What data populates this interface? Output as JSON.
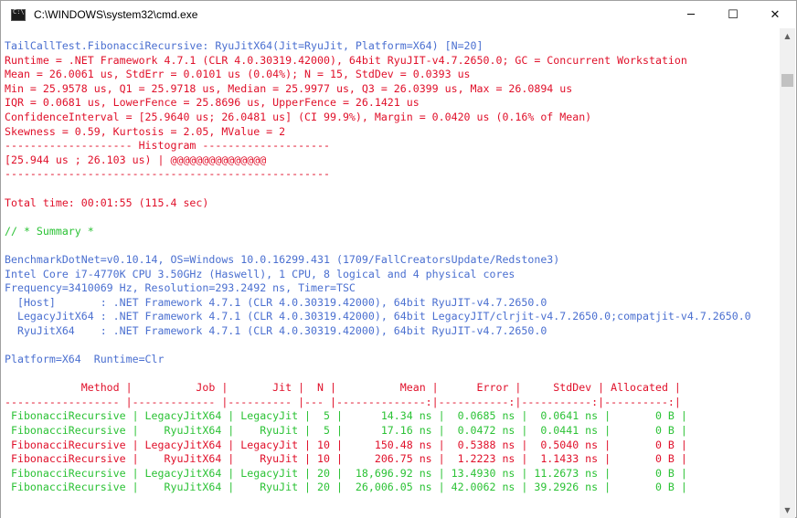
{
  "window": {
    "title": "C:\\WINDOWS\\system32\\cmd.exe",
    "minimize": "─",
    "maximize": "☐",
    "close": "✕"
  },
  "scrollbar": {
    "up": "▲",
    "down": "▼"
  },
  "console": {
    "lines": [
      {
        "color": "blue",
        "text": "TailCallTest.FibonacciRecursive: RyuJitX64(Jit=RyuJit, Platform=X64) [N=20]"
      },
      {
        "color": "red",
        "text": "Runtime = .NET Framework 4.7.1 (CLR 4.0.30319.42000), 64bit RyuJIT-v4.7.2650.0; GC = Concurrent Workstation"
      },
      {
        "color": "red",
        "text": "Mean = 26.0061 us, StdErr = 0.0101 us (0.04%); N = 15, StdDev = 0.0393 us"
      },
      {
        "color": "red",
        "text": "Min = 25.9578 us, Q1 = 25.9718 us, Median = 25.9977 us, Q3 = 26.0399 us, Max = 26.0894 us"
      },
      {
        "color": "red",
        "text": "IQR = 0.0681 us, LowerFence = 25.8696 us, UpperFence = 26.1421 us"
      },
      {
        "color": "red",
        "text": "ConfidenceInterval = [25.9640 us; 26.0481 us] (CI 99.9%), Margin = 0.0420 us (0.16% of Mean)"
      },
      {
        "color": "red",
        "text": "Skewness = 0.59, Kurtosis = 2.05, MValue = 2"
      },
      {
        "color": "red",
        "text": "-------------------- Histogram --------------------"
      },
      {
        "color": "red",
        "text": "[25.944 us ; 26.103 us) | @@@@@@@@@@@@@@@"
      },
      {
        "color": "red",
        "text": "---------------------------------------------------"
      },
      {
        "color": "red",
        "text": ""
      },
      {
        "color": "red",
        "text": "Total time: 00:01:55 (115.4 sec)"
      },
      {
        "color": "red",
        "text": ""
      },
      {
        "color": "green",
        "text": "// * Summary *"
      },
      {
        "color": "green",
        "text": ""
      },
      {
        "color": "blue",
        "text": "BenchmarkDotNet=v0.10.14, OS=Windows 10.0.16299.431 (1709/FallCreatorsUpdate/Redstone3)"
      },
      {
        "color": "blue",
        "text": "Intel Core i7-4770K CPU 3.50GHz (Haswell), 1 CPU, 8 logical and 4 physical cores"
      },
      {
        "color": "blue",
        "text": "Frequency=3410069 Hz, Resolution=293.2492 ns, Timer=TSC"
      },
      {
        "color": "blue",
        "text": "  [Host]       : .NET Framework 4.7.1 (CLR 4.0.30319.42000), 64bit RyuJIT-v4.7.2650.0"
      },
      {
        "color": "blue",
        "text": "  LegacyJitX64 : .NET Framework 4.7.1 (CLR 4.0.30319.42000), 64bit LegacyJIT/clrjit-v4.7.2650.0;compatjit-v4.7.2650.0"
      },
      {
        "color": "blue",
        "text": "  RyuJitX64    : .NET Framework 4.7.1 (CLR 4.0.30319.42000), 64bit RyuJIT-v4.7.2650.0"
      },
      {
        "color": "blue",
        "text": ""
      },
      {
        "color": "blue",
        "text": "Platform=X64  Runtime=Clr"
      },
      {
        "color": "blue",
        "text": ""
      },
      {
        "color": "red",
        "text": "            Method |          Job |       Jit |  N |          Mean |      Error |     StdDev | Allocated |"
      },
      {
        "color": "red",
        "text": "------------------ |------------- |---------- |--- |--------------:|-----------:|-----------:|----------:|"
      },
      {
        "color": "green",
        "text": " FibonacciRecursive | LegacyJitX64 | LegacyJit |  5 |      14.34 ns |  0.0685 ns |  0.0641 ns |       0 B |"
      },
      {
        "color": "green",
        "text": " FibonacciRecursive |    RyuJitX64 |    RyuJit |  5 |      17.16 ns |  0.0472 ns |  0.0441 ns |       0 B |"
      },
      {
        "color": "red",
        "text": " FibonacciRecursive | LegacyJitX64 | LegacyJit | 10 |     150.48 ns |  0.5388 ns |  0.5040 ns |       0 B |"
      },
      {
        "color": "red",
        "text": " FibonacciRecursive |    RyuJitX64 |    RyuJit | 10 |     206.75 ns |  1.2223 ns |  1.1433 ns |       0 B |"
      },
      {
        "color": "green",
        "text": " FibonacciRecursive | LegacyJitX64 | LegacyJit | 20 |  18,696.92 ns | 13.4930 ns | 11.2673 ns |       0 B |"
      },
      {
        "color": "green",
        "text": " FibonacciRecursive |    RyuJitX64 |    RyuJit | 20 |  26,006.05 ns | 42.0062 ns | 39.2926 ns |       0 B |"
      }
    ]
  }
}
